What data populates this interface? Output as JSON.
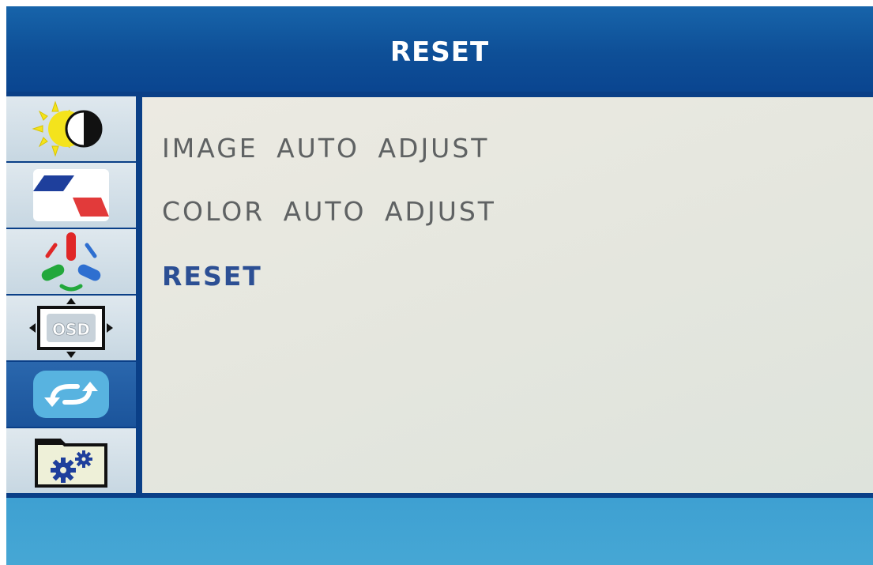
{
  "header": {
    "title": "RESET"
  },
  "sidebar": {
    "tabs": [
      {
        "icon": "brightness-contrast-icon",
        "selected": false
      },
      {
        "icon": "image-setup-icon",
        "selected": false
      },
      {
        "icon": "color-temperature-icon",
        "selected": false
      },
      {
        "icon": "osd-setup-icon",
        "selected": false
      },
      {
        "icon": "reset-icon",
        "selected": true
      },
      {
        "icon": "misc-settings-icon",
        "selected": false
      }
    ]
  },
  "menu": {
    "items": [
      {
        "label": "IMAGE AUTO ADJUST",
        "active": false
      },
      {
        "label": "COLOR AUTO ADJUST",
        "active": false
      },
      {
        "label": "RESET",
        "active": true
      }
    ]
  },
  "colors": {
    "title_bar": "#0e4f97",
    "selected_tab": "#1b549b",
    "active_text": "#2c4f94",
    "inactive_text": "#5f6263",
    "content_bg": "#e6e7df"
  }
}
